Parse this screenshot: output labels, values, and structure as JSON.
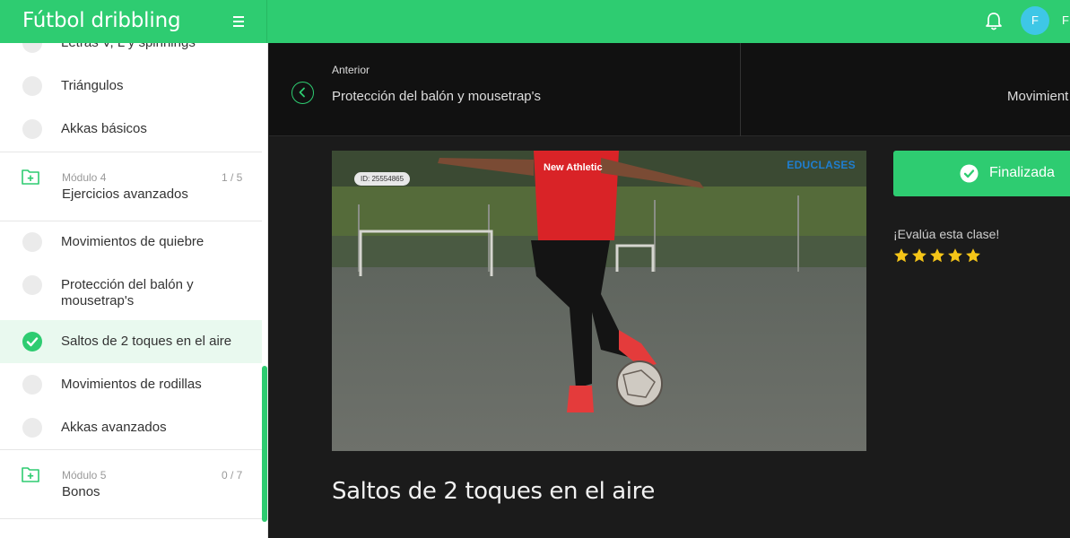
{
  "header": {
    "course_title": "Fútbol dribbling",
    "user_initial": "F",
    "user_name_partial": "F"
  },
  "sidebar": {
    "lessons_top": [
      {
        "label": "Letras V, L y spinnings",
        "done": false
      },
      {
        "label": "Triángulos",
        "done": false
      },
      {
        "label": "Akkas básicos",
        "done": false
      }
    ],
    "module_4": {
      "number_label": "Módulo 4",
      "title": "Ejercicios avanzados",
      "progress": "1 / 5"
    },
    "lessons_mod4": [
      {
        "label": "Movimientos de quiebre",
        "done": false
      },
      {
        "label": "Protección del balón y mousetrap's",
        "done": false
      },
      {
        "label": "Saltos de 2 toques en el aire",
        "done": true,
        "active": true
      },
      {
        "label": "Movimientos de rodillas",
        "done": false
      },
      {
        "label": "Akkas avanzados",
        "done": false
      }
    ],
    "module_5": {
      "number_label": "Módulo 5",
      "title": "Bonos",
      "progress": "0 / 7"
    }
  },
  "nav": {
    "prev_label": "Anterior",
    "prev_title": "Protección del balón y mousetrap's",
    "next_title_partial": "Movimient"
  },
  "video": {
    "id_tag": "ID: 25554865",
    "watermark": "EDUCLASES",
    "shirt_brand": "New Athletic"
  },
  "actions": {
    "finalize_label": "Finalizada",
    "rate_prompt": "¡Evalúa esta clase!",
    "stars": 5
  },
  "lesson_title": "Saltos de 2 toques en el aire",
  "colors": {
    "accent": "#2ecc71",
    "dark_bg": "#1b1b1b",
    "nav_bg": "#111111",
    "star": "#f5c518"
  }
}
